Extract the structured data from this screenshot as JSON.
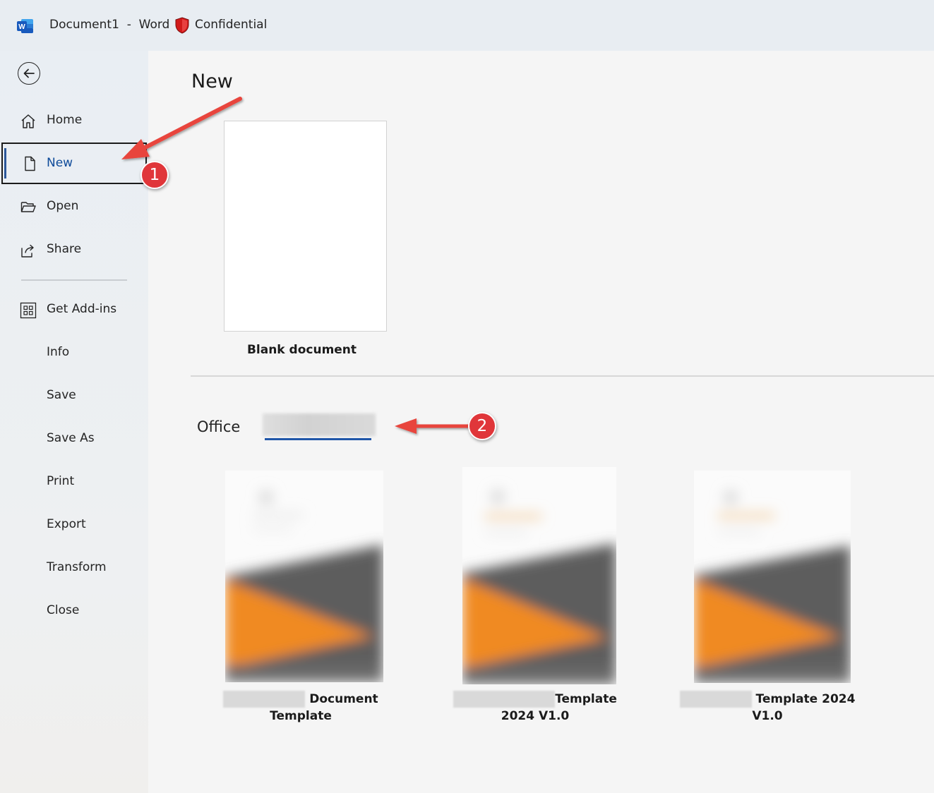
{
  "titlebar": {
    "app_icon": "word-app-icon",
    "title": "Document1  -  Word",
    "sensitivity_icon": "red-shield-icon",
    "sensitivity_label": "Confidential"
  },
  "sidebar": {
    "back_icon": "back-arrow-icon",
    "items": [
      {
        "label": "Home",
        "icon": "home-icon"
      },
      {
        "label": "New",
        "icon": "new-document-icon",
        "active": true
      },
      {
        "label": "Open",
        "icon": "folder-open-icon"
      },
      {
        "label": "Share",
        "icon": "share-icon"
      },
      {
        "label": "Get Add-ins",
        "icon": "grid-icon"
      },
      {
        "label": "Info"
      },
      {
        "label": "Save"
      },
      {
        "label": "Save As"
      },
      {
        "label": "Print"
      },
      {
        "label": "Export"
      },
      {
        "label": "Transform"
      },
      {
        "label": "Close"
      }
    ]
  },
  "main": {
    "title": "New",
    "blank": {
      "caption": "Blank document"
    },
    "tabs": [
      {
        "label": "Office"
      },
      {
        "label": "",
        "active": true,
        "redacted": true
      }
    ],
    "templates": [
      {
        "caption_line1": "Document",
        "caption_line2": "Template"
      },
      {
        "caption_line1": "Template",
        "caption_line2": "2024 V1.0"
      },
      {
        "caption_line1": "Template 2024",
        "caption_line2": "V1.0"
      }
    ]
  },
  "annotations": {
    "badges": [
      "1",
      "2"
    ],
    "color": "#e0363a"
  },
  "colors": {
    "accent": "#2b579a",
    "active_text": "#0f4b9a",
    "tab_underline": "#1f56a8",
    "template_orange": "#f08a24"
  }
}
